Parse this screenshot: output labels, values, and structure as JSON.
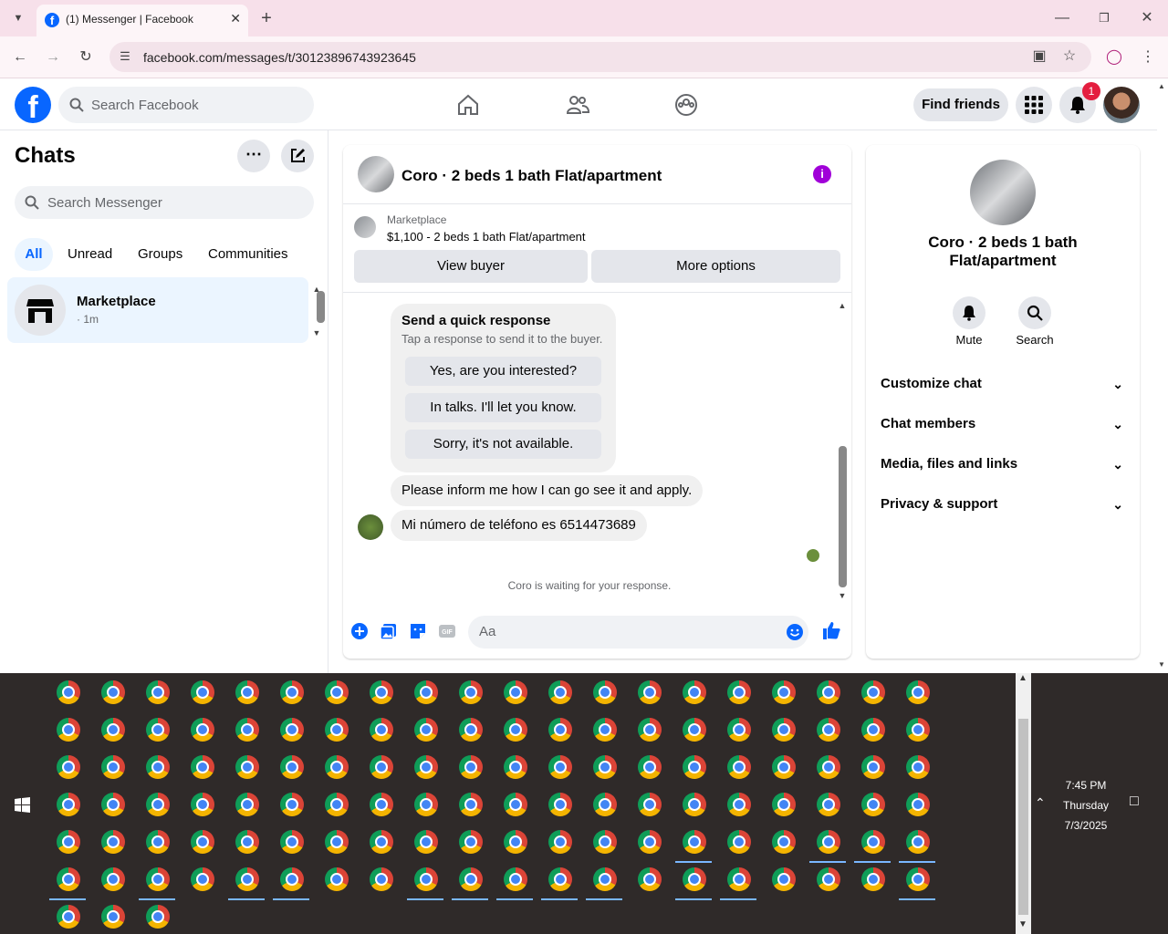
{
  "browser": {
    "tab_title": "(1) Messenger | Facebook",
    "url": "facebook.com/messages/t/30123896743923645"
  },
  "fb": {
    "logo_letter": "f",
    "search_placeholder": "Search Facebook",
    "find_friends": "Find friends",
    "notification_count": "1"
  },
  "sidebar": {
    "title": "Chats",
    "search_placeholder": "Search Messenger",
    "filters": [
      "All",
      "Unread",
      "Groups",
      "Communities"
    ],
    "conversation": {
      "name": "Marketplace",
      "time": "· 1m"
    }
  },
  "chat": {
    "title": "Coro · 2 beds 1 bath Flat/apartment",
    "marketplace_label": "Marketplace",
    "listing": "$1,100 - 2 beds 1 bath Flat/apartment",
    "view_buyer": "View buyer",
    "more_options": "More options",
    "quick_response": {
      "heading": "Send a quick response",
      "subtitle": "Tap a response to send it to the buyer.",
      "options": [
        "Yes, are you interested?",
        "In talks. I'll let you know.",
        "Sorry, it's not available."
      ]
    },
    "messages": [
      "Please inform me how I can go see it and apply.",
      "Mi número de teléfono es 6514473689"
    ],
    "waiting_text": "Coro is waiting for your response.",
    "input_placeholder": "Aa"
  },
  "right_panel": {
    "name": "Coro · 2 beds 1 bath Flat/apartment",
    "mute": "Mute",
    "search": "Search",
    "sections": [
      "Customize chat",
      "Chat members",
      "Media, files and links",
      "Privacy & support"
    ]
  },
  "taskbar": {
    "time": "7:45 PM",
    "day": "Thursday",
    "date": "7/3/2025"
  },
  "colors": {
    "fb_blue": "#0866ff",
    "tab_bar": "#f7e0ea",
    "info_purple": "#a000d8"
  }
}
